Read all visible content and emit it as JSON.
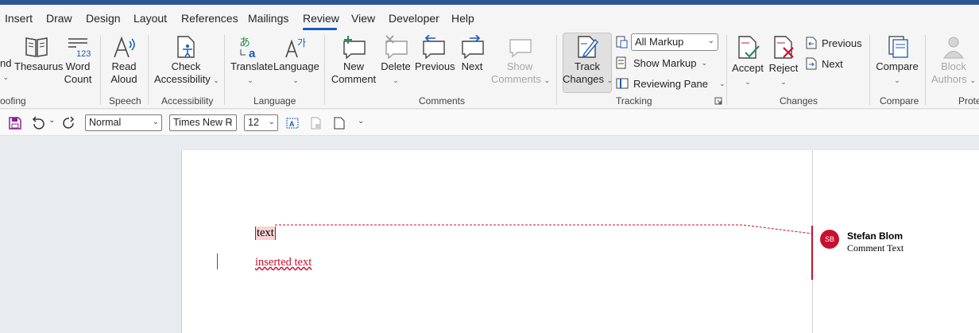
{
  "tabs": [
    "Insert",
    "Draw",
    "Design",
    "Layout",
    "References",
    "Mailings",
    "Review",
    "View",
    "Developer",
    "Help"
  ],
  "active_tab": "Review",
  "accent_color": "#185abd",
  "markup_color": "#c8102e",
  "ribbon": {
    "proofing": {
      "partial_button_line1": "nd",
      "thesaurus": "Thesaurus",
      "word_count_l1": "Word",
      "word_count_l2": "Count",
      "label": "oofing"
    },
    "speech": {
      "read_aloud_l1": "Read",
      "read_aloud_l2": "Aloud",
      "label": "Speech"
    },
    "accessibility": {
      "check_l1": "Check",
      "check_l2": "Accessibility",
      "label": "Accessibility"
    },
    "language": {
      "translate": "Translate",
      "language": "Language",
      "label": "Language"
    },
    "comments": {
      "new_l1": "New",
      "new_l2": "Comment",
      "delete": "Delete",
      "previous": "Previous",
      "next": "Next",
      "show_l1": "Show",
      "show_l2": "Comments",
      "label": "Comments"
    },
    "tracking": {
      "track_l1": "Track",
      "track_l2": "Changes",
      "markup_select": "All Markup",
      "show_markup": "Show Markup",
      "reviewing_pane": "Reviewing Pane",
      "label": "Tracking"
    },
    "changes": {
      "accept": "Accept",
      "reject": "Reject",
      "previous": "Previous",
      "next": "Next",
      "label": "Changes"
    },
    "compare": {
      "compare": "Compare",
      "label": "Compare"
    },
    "protect": {
      "block_l1": "Block",
      "block_l2": "Authors",
      "label": "Prote"
    }
  },
  "toolbar": {
    "style": "Normal",
    "font": "Times New R",
    "size": "12"
  },
  "document": {
    "commented_text": "text",
    "inserted_text": "inserted text"
  },
  "comment": {
    "initials": "SB",
    "author": "Stefan Blom",
    "text": "Comment Text"
  }
}
